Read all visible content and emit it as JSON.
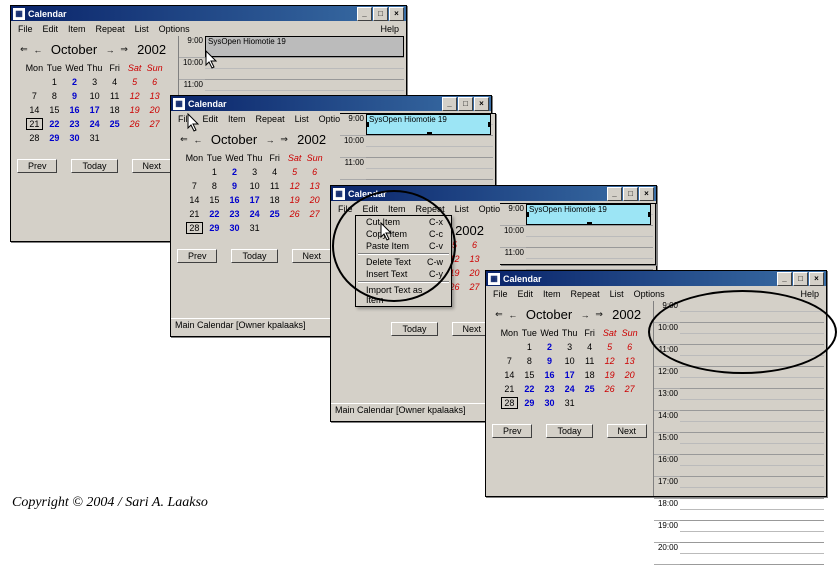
{
  "app_title": "Calendar",
  "menus": {
    "file": "File",
    "edit": "Edit",
    "item": "Item",
    "repeat": "Repeat",
    "list": "List",
    "options": "Options",
    "help": "Help"
  },
  "month_name": "October",
  "year": "2002",
  "dow": [
    "Mon",
    "Tue",
    "Wed",
    "Thu",
    "Fri",
    "Sat",
    "Sun"
  ],
  "weeks": [
    [
      "",
      "1",
      "2",
      "3",
      "4",
      "5",
      "6"
    ],
    [
      "7",
      "8",
      "9",
      "10",
      "11",
      "12",
      "13"
    ],
    [
      "14",
      "15",
      "16",
      "17",
      "18",
      "19",
      "20"
    ],
    [
      "21",
      "22",
      "23",
      "24",
      "25",
      "26",
      "27"
    ],
    [
      "28",
      "29",
      "30",
      "31",
      "",
      "",
      ""
    ]
  ],
  "blue_days": [
    "2",
    "9",
    "16",
    "17",
    "22",
    "23",
    "24",
    "25",
    "29",
    "30"
  ],
  "today_cell": "28",
  "today_cell_alt": "21",
  "nav": {
    "prev": "Prev",
    "today": "Today",
    "next": "Next"
  },
  "times": [
    "9:00",
    "10:00",
    "11:00",
    "12:00",
    "13:00",
    "14:00",
    "15:00",
    "16:00",
    "17:00",
    "18:00",
    "19:00",
    "20:00"
  ],
  "appt_text": "SysOpen Hiomotie 19",
  "status_text": "Main Calendar [Owner kpalaaks]",
  "edit_menu": [
    {
      "label": "Cut Item",
      "sc": "C-x"
    },
    {
      "label": "Copy Item",
      "sc": "C-c"
    },
    {
      "label": "Paste Item",
      "sc": "C-v"
    },
    {
      "sep": true
    },
    {
      "label": "Delete Text",
      "sc": "C-w"
    },
    {
      "label": "Insert Text",
      "sc": "C-y"
    },
    {
      "sep": true
    },
    {
      "label": "Import Text as Item",
      "sc": ""
    }
  ],
  "copyright": "Copyright © 2004 / Sari A. Laakso"
}
